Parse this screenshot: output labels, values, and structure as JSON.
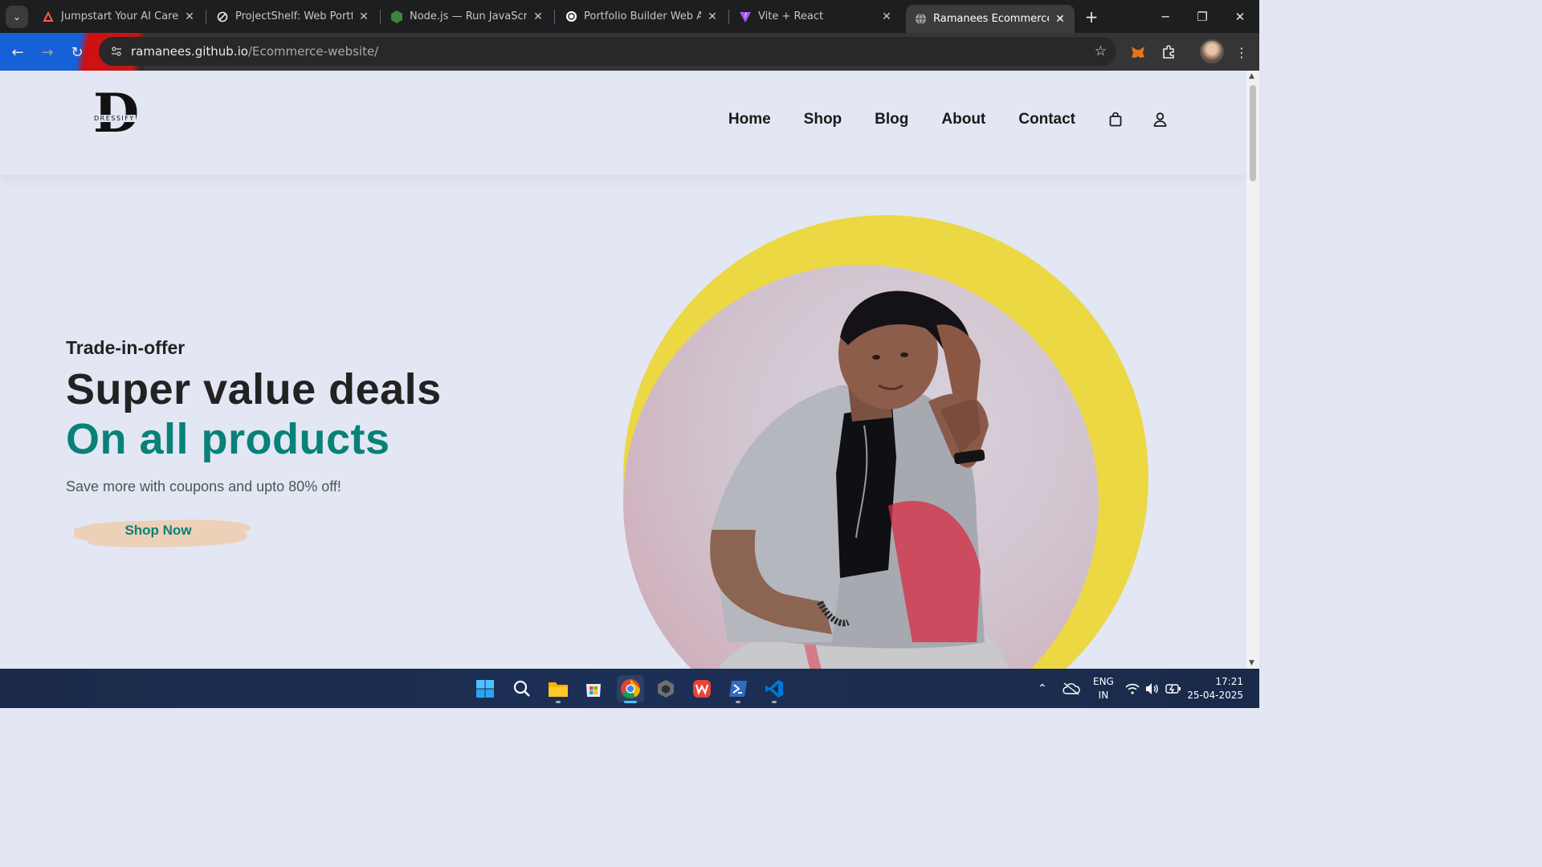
{
  "browser": {
    "tabs": [
      {
        "title": "Jumpstart Your AI Career in",
        "icon": "ai-career-icon",
        "active": false
      },
      {
        "title": "ProjectShelf: Web Portfolio",
        "icon": "projectshelf-icon",
        "active": false
      },
      {
        "title": "Node.js — Run JavaScript E",
        "icon": "nodejs-icon",
        "active": false
      },
      {
        "title": "Portfolio Builder Web App",
        "icon": "openai-icon",
        "active": false
      },
      {
        "title": "Vite + React",
        "icon": "vite-icon",
        "active": false
      },
      {
        "title": "Ramanees Ecommerce Wel",
        "icon": "globe-icon",
        "active": true
      }
    ],
    "url_host": "ramanees.github.io",
    "url_path": "/Ecommerce-website/"
  },
  "site": {
    "logo_letter": "D",
    "logo_text": "DRESSIFY",
    "nav": [
      "Home",
      "Shop",
      "Blog",
      "About",
      "Contact"
    ],
    "hero": {
      "kicker": "Trade-in-offer",
      "headline": "Super value deals",
      "headline_accent": "On all products",
      "subtext": "Save more with coupons and upto 80% off!",
      "cta": "Shop Now"
    },
    "colors": {
      "accent": "#088178",
      "background": "#e3e6f3",
      "ring": "#ecd843",
      "cta_brush": "#ecd0b8"
    }
  },
  "taskbar": {
    "apps": [
      "windows-start-icon",
      "search-icon",
      "file-explorer-icon",
      "microsoft-store-icon",
      "chrome-icon",
      "unity-icon",
      "wps-office-icon",
      "powershell-icon",
      "vscode-icon"
    ],
    "lang_top": "ENG",
    "lang_bottom": "IN",
    "time": "17:21",
    "date": "25-04-2025"
  }
}
